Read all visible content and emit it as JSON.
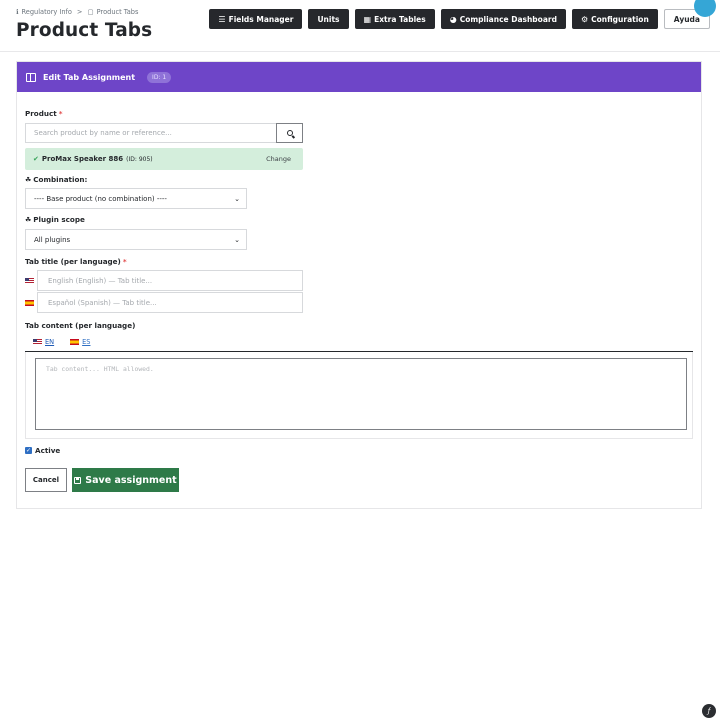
{
  "breadcrumb": {
    "root": "Regulatory Info",
    "separator": ">",
    "current": "Product Tabs"
  },
  "page_title": "Product Tabs",
  "toolbar": {
    "buttons": [
      {
        "label": "Fields Manager",
        "icon": "list-icon"
      },
      {
        "label": "Units",
        "icon": ""
      },
      {
        "label": "Extra Tables",
        "icon": "table-icon"
      },
      {
        "label": "Compliance Dashboard",
        "icon": "dashboard-icon"
      },
      {
        "label": "Configuration",
        "icon": "gears-icon"
      },
      {
        "label": "Ayuda",
        "icon": ""
      }
    ]
  },
  "card": {
    "title": "Edit Tab Assignment",
    "id_badge": "ID: 1",
    "accent_color": "#6e45c8"
  },
  "form": {
    "product_label": "Product",
    "required_mark": "*",
    "search_placeholder": "Search product by name or reference...",
    "selected_product": {
      "name": "ProMax Speaker 886",
      "id_text": "(ID: 905)",
      "change_label": "Change"
    },
    "combination_label": "Combination:",
    "combination_value": "---- Base product (no combination) ----",
    "plugin_scope_label": "Plugin scope",
    "plugin_scope_value": "All plugins",
    "tab_title_label": "Tab title (per language)",
    "title_en_placeholder": "English (English) — Tab title...",
    "title_es_placeholder": "Español (Spanish) — Tab title...",
    "tab_content_label": "Tab content (per language)",
    "content_tabs": [
      {
        "code": "EN"
      },
      {
        "code": "ES"
      }
    ],
    "content_placeholder": "Tab content... HTML allowed.",
    "active_label": "Active",
    "active_checked": true,
    "cancel_label": "Cancel",
    "save_label": "Save assignment",
    "save_color": "#2e7a48"
  }
}
